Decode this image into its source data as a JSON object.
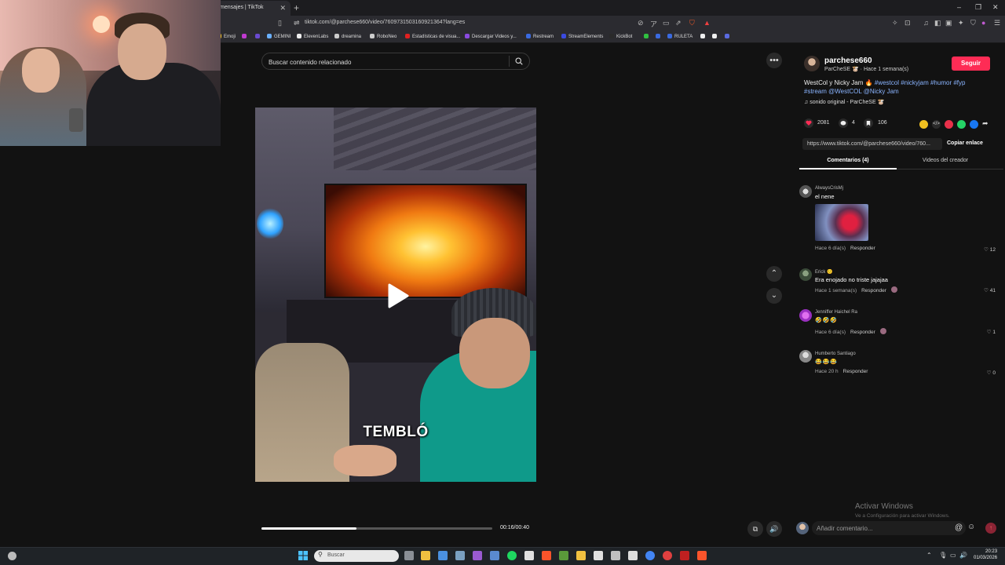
{
  "browser": {
    "tab_title": "mensajes | TikTok",
    "url": "tiktok.com/@parchese660/video/7609731503160921364?lang=es",
    "bookmarks": [
      {
        "label": "Emoji",
        "color": "#f0c020"
      },
      {
        "label": "",
        "color": "#c03ad0"
      },
      {
        "label": "",
        "color": "#6a4ad0"
      },
      {
        "label": "GEMINI",
        "color": "#6ab0ff"
      },
      {
        "label": "ElevenLabs",
        "color": "#eeeeee"
      },
      {
        "label": "dreamina",
        "color": "#cccccc"
      },
      {
        "label": "RoboNeo",
        "color": "#cccccc"
      },
      {
        "label": "Estadísticas de visua...",
        "color": "#e02020"
      },
      {
        "label": "Descargar Videos y...",
        "color": "#8a4ae0"
      },
      {
        "label": "Restream",
        "color": "#3a6ae0"
      },
      {
        "label": "StreamElements",
        "color": "#3a4ae0"
      },
      {
        "label": "KickBot",
        "color": "#2a2a2a"
      },
      {
        "label": "",
        "color": "#30c040"
      },
      {
        "label": "",
        "color": "#3a6ae0"
      },
      {
        "label": "RULETA",
        "color": "#3a6ae0"
      },
      {
        "label": "",
        "color": "#eeeeee"
      },
      {
        "label": "",
        "color": "#eeeeee"
      },
      {
        "label": "",
        "color": "#5a6ae0"
      }
    ]
  },
  "video": {
    "search_placeholder": "Buscar contenido relacionado",
    "caption": "TEMBLÓ",
    "timecode": "00:16/00:40",
    "progress": 0.41
  },
  "post": {
    "author": "parchese660",
    "author_sub": "ParCheSE 🐮 · Hace 1 semana(s)",
    "follow_label": "Seguir",
    "description_plain": "WestCol y Nicky Jam 🔥",
    "hashtags_line1": "#westcol #nickyjam #humor #fyp",
    "hashtags_line2": "#stream @WestCOL @Nicky Jam",
    "sound": "♫  sonido original - ParCheSE 🐮",
    "likes": "2081",
    "comments": "4",
    "saves": "106",
    "link": "https://www.tiktok.com/@parchese660/video/760...",
    "copy_label": "Copiar enlace",
    "tab_comments": "Comentarios (4)",
    "tab_videos": "Videos del creador"
  },
  "comments": [
    {
      "user": "AlwaysCrisMj",
      "text": "el nene",
      "time": "Hace 6 día(s)",
      "reply": "Responder",
      "likes": "12"
    },
    {
      "user": "Erick 🙂",
      "text": "Era enojado no triste jajajaa",
      "time": "Hace 1 semana(s)",
      "reply": "Responder",
      "likes": "41"
    },
    {
      "user": "Jenniffer Haichel Ra",
      "text": "🤣🤣🤣",
      "time": "Hace 6 día(s)",
      "reply": "Responder",
      "likes": "1"
    },
    {
      "user": "Humberto Santiago",
      "text": "😂😂😂",
      "time": "Hace 20 h",
      "reply": "Responder",
      "likes": "0"
    }
  ],
  "comment_input_placeholder": "Añadir comentario...",
  "watermark": {
    "line1": "Activar Windows",
    "line2": "Ve a Configuración para activar Windows."
  },
  "taskbar": {
    "search_label": "Buscar",
    "time": "20:23",
    "date": "01/03/2026"
  },
  "colors": {
    "accent": "#fe2c55",
    "hashtag": "#8ab4ff",
    "background": "#121212"
  }
}
